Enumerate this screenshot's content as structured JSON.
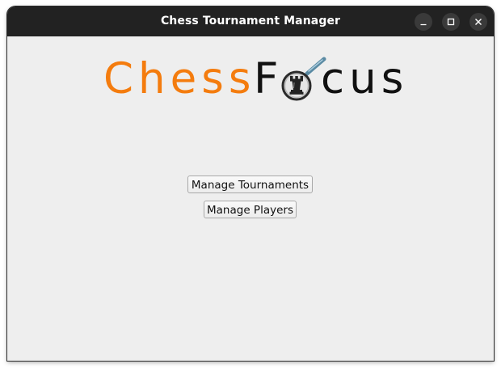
{
  "window": {
    "title": "Chess Tournament Manager",
    "controls": [
      "minimize",
      "maximize",
      "close"
    ]
  },
  "logo": {
    "part_orange": "Chess",
    "part_dark_F": "F",
    "part_dark_rest": "cus",
    "icon": "magnifier-rook-icon",
    "colors": {
      "orange": "#f47c0e",
      "dark": "#111111"
    }
  },
  "menu": {
    "manage_tournaments": "Manage Tournaments",
    "manage_players": "Manage Players"
  },
  "colors": {
    "titlebar": "#222222",
    "background": "#eeeeee"
  }
}
